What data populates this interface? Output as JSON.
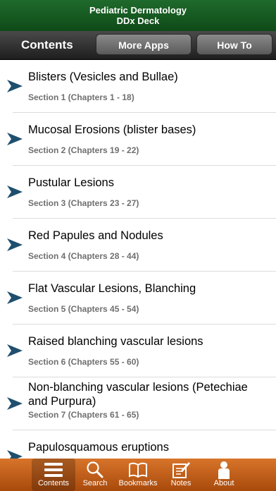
{
  "app": {
    "title_line1": "Pediatric Dermatology",
    "title_line2": "DDx Deck"
  },
  "navbar": {
    "title": "Contents",
    "more_apps": "More Apps",
    "how_to": "How To"
  },
  "sections": [
    {
      "title": "Blisters (Vesicles and Bullae)",
      "subtitle": "Section 1 (Chapters 1 - 18)"
    },
    {
      "title": "Mucosal Erosions (blister bases)",
      "subtitle": "Section 2 (Chapters 19 - 22)"
    },
    {
      "title": "Pustular Lesions",
      "subtitle": "Section 3 (Chapters 23 - 27)"
    },
    {
      "title": "Red Papules and Nodules",
      "subtitle": "Section 4 (Chapters 28 - 44)"
    },
    {
      "title": "Flat Vascular Lesions, Blanching",
      "subtitle": "Section 5 (Chapters 45 - 54)"
    },
    {
      "title": "Raised blanching vascular lesions",
      "subtitle": "Section 6 (Chapters 55 - 60)"
    },
    {
      "title": "Non-blanching vascular lesions (Petechiae and Purpura)",
      "subtitle": "Section 7 (Chapters 61 - 65)"
    },
    {
      "title": "Papulosquamous eruptions",
      "subtitle": ""
    }
  ],
  "tabs": [
    {
      "label": "Contents",
      "icon": "list-icon",
      "active": true
    },
    {
      "label": "Search",
      "icon": "search-icon",
      "active": false
    },
    {
      "label": "Bookmarks",
      "icon": "book-icon",
      "active": false
    },
    {
      "label": "Notes",
      "icon": "notes-icon",
      "active": false
    },
    {
      "label": "About",
      "icon": "person-icon",
      "active": false
    }
  ],
  "colors": {
    "titlebar": "#1a5e26",
    "tabbar": "#c4601a",
    "chevron": "#1f4f6e"
  }
}
